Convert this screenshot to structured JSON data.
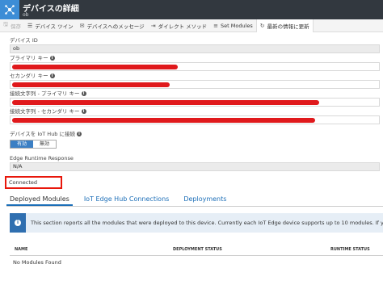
{
  "header": {
    "title": "デバイスの詳細",
    "subtitle": "ob"
  },
  "toolbar": {
    "items": [
      {
        "icon": "save-icon",
        "glyph": "🖫",
        "label": "保存",
        "disabled": true
      },
      {
        "icon": "device-twin-icon",
        "glyph": "☰",
        "label": "デバイス ツイン",
        "disabled": false
      },
      {
        "icon": "message-icon",
        "glyph": "✉",
        "label": "デバイスへのメッセージ",
        "disabled": false
      },
      {
        "icon": "direct-method-icon",
        "glyph": "⇥",
        "label": "ダイレクト メソッド",
        "disabled": false
      },
      {
        "icon": "set-modules-icon",
        "glyph": "≡",
        "label": "Set Modules",
        "disabled": false
      },
      {
        "icon": "refresh-icon",
        "glyph": "↻",
        "label": "最新の情報に更新",
        "disabled": false
      }
    ]
  },
  "fields": {
    "device_id": {
      "label": "デバイス ID",
      "value": "ob"
    },
    "primary_key": {
      "label": "プライマリ キー"
    },
    "secondary_key": {
      "label": "セカンダリ キー"
    },
    "conn_primary": {
      "label": "接続文字列 - プライマリ キー"
    },
    "conn_secondary": {
      "label": "接続文字列 - セカンダリ キー"
    },
    "iot_hub_connect": {
      "label": "デバイスを IoT Hub に接続",
      "on_label": "有効",
      "off_label": "無効"
    },
    "edge_runtime": {
      "label": "Edge Runtime Response",
      "value": "N/A"
    }
  },
  "status": "Connected",
  "tabs": [
    "Deployed Modules",
    "IoT Edge Hub Connections",
    "Deployments"
  ],
  "notice": "This section reports all the modules that were deployed to this device. Currently each IoT Edge device supports up to 10 modules. If you want to",
  "table": {
    "columns": [
      "NAME",
      "DEPLOYMENT STATUS",
      "RUNTIME STATUS"
    ],
    "empty_message": "No Modules Found"
  },
  "colors": {
    "header_bg": "#32383f",
    "accent": "#1d6fb8",
    "redaction": "#e0191c",
    "highlight_box": "#e8170b"
  }
}
